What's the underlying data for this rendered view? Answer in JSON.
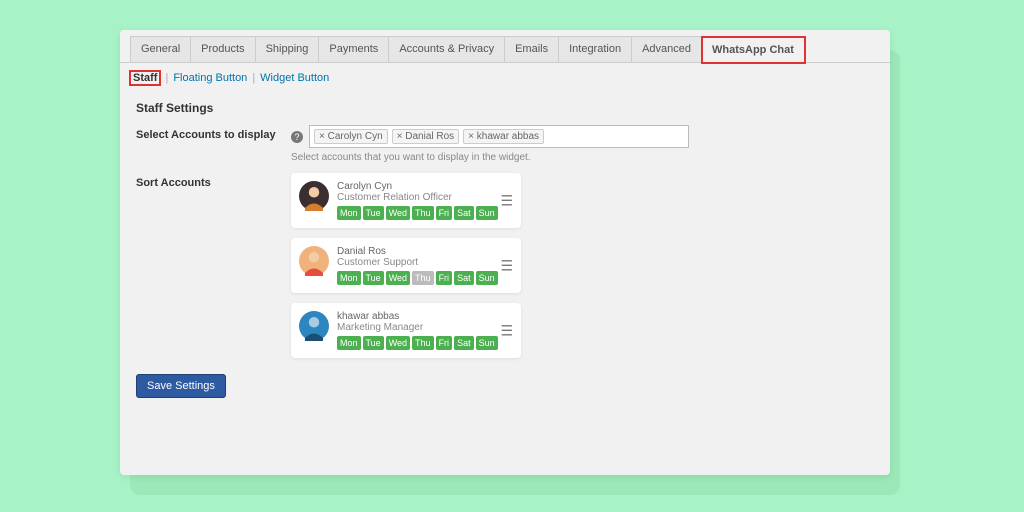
{
  "tabs": [
    "General",
    "Products",
    "Shipping",
    "Payments",
    "Accounts & Privacy",
    "Emails",
    "Integration",
    "Advanced",
    "WhatsApp Chat"
  ],
  "active_tab": "WhatsApp Chat",
  "subtabs": [
    "Staff",
    "Floating Button",
    "Widget Button"
  ],
  "active_subtab": "Staff",
  "section_title": "Staff Settings",
  "fields": {
    "accounts": {
      "label": "Select Accounts to display",
      "help": "Select accounts that you want to display in the widget.",
      "tags": [
        "Carolyn Cyn",
        "Danial Ros",
        "khawar abbas"
      ]
    },
    "sort": {
      "label": "Sort Accounts"
    }
  },
  "days": [
    "Mon",
    "Tue",
    "Wed",
    "Thu",
    "Fri",
    "Sat",
    "Sun"
  ],
  "staff": [
    {
      "name": "Carolyn Cyn",
      "role": "Customer Relation Officer",
      "off_days": [],
      "avatar_color_a": "#3a2e2e",
      "avatar_color_b": "#f5cba7",
      "avatar_color_c": "#d47f2e"
    },
    {
      "name": "Danial Ros",
      "role": "Customer Support",
      "off_days": [
        "Thu"
      ],
      "avatar_color_a": "#f0b27a",
      "avatar_color_b": "#f5cba7",
      "avatar_color_c": "#e74c3c"
    },
    {
      "name": "khawar abbas",
      "role": "Marketing Manager",
      "off_days": [],
      "avatar_color_a": "#2e86c1",
      "avatar_color_b": "#a9cce3",
      "avatar_color_c": "#1b4f72"
    }
  ],
  "save_label": "Save Settings"
}
